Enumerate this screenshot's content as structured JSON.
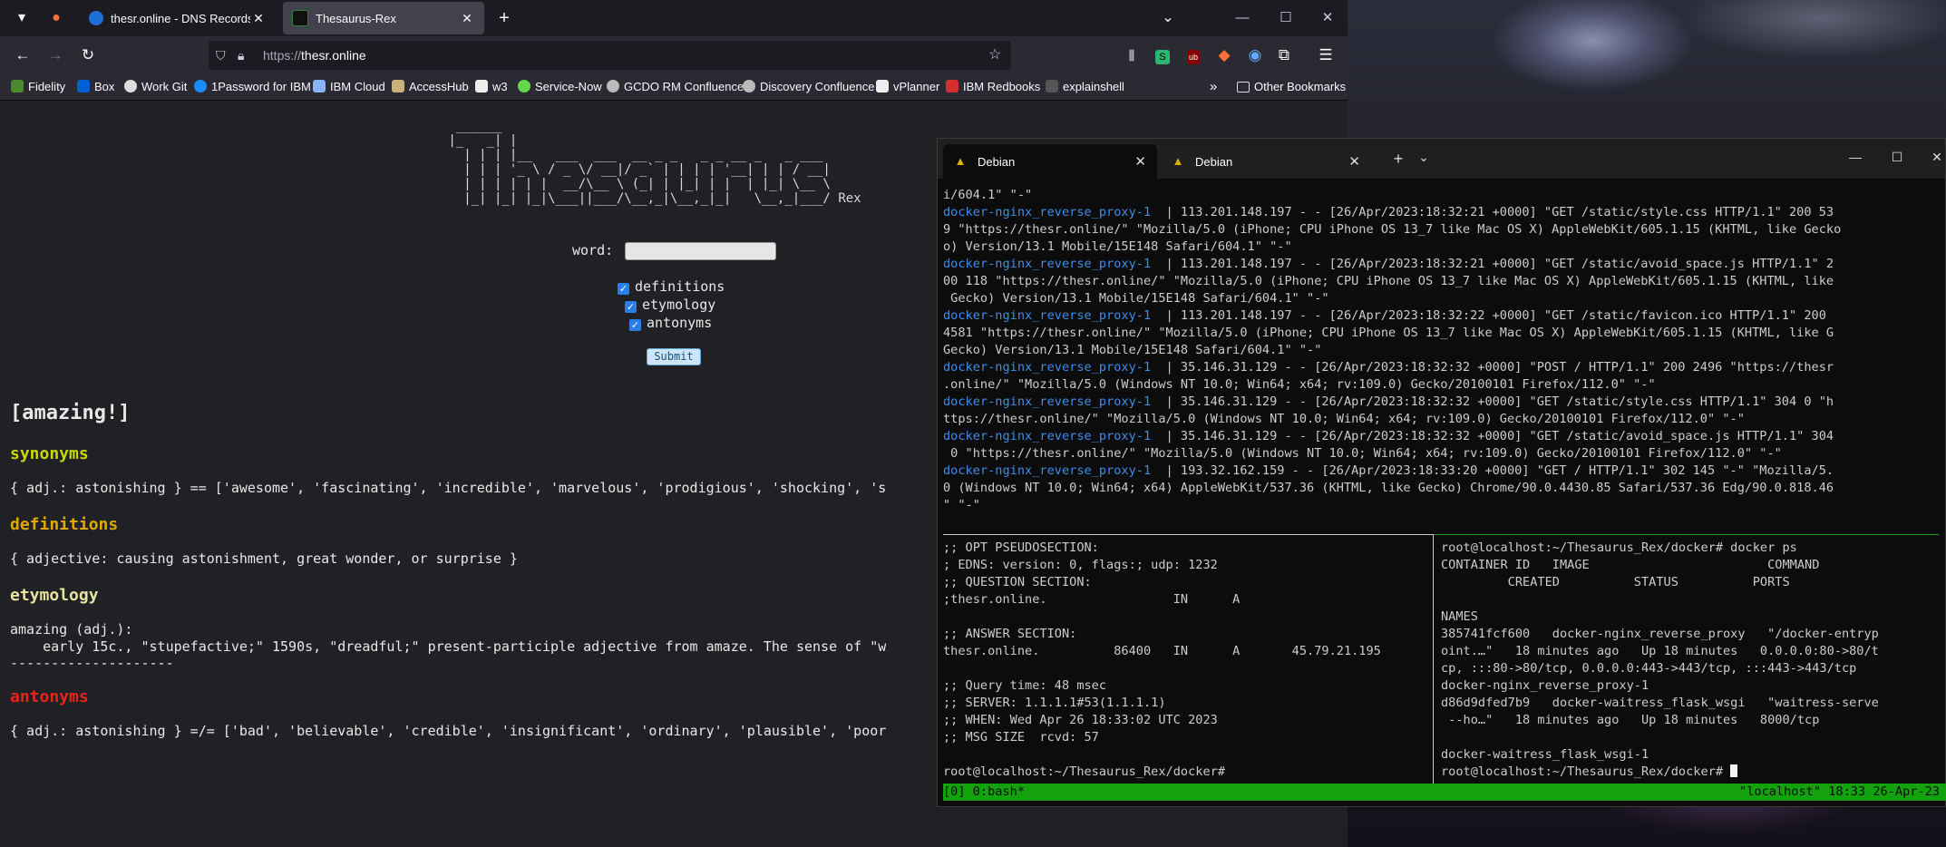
{
  "browser": {
    "tabs": [
      {
        "title": "thesr.online - DNS Records | Lin",
        "active": false
      },
      {
        "title": "Thesaurus-Rex",
        "active": true
      }
    ],
    "url_prefix": "https://",
    "url_host": "thesr.online",
    "bookmarks": [
      "Fidelity",
      "Box",
      "Work Git",
      "1Password for IBM",
      "IBM Cloud",
      "AccessHub",
      "w3",
      "Service-Now",
      "GCDO RM Confluence",
      "Discovery Confluence",
      "vPlanner",
      "IBM Redbooks",
      "explainshell"
    ],
    "other_bookmarks": "Other Bookmarks"
  },
  "page": {
    "logo_ascii": "  ______                                          \n |_   _| |                                        \n   | | | |__   ___  ___  __ _ _   _ _ __ _   _ ___ \n   | | | '_ \\ / _ \\/ __|/ _` | | | | '__| | | / __|\n   | | | | | |  __/\\__ \\ (_| | |_| | |  | |_| \\__ \\\n   |_| |_| |_|\\___||___/\\__,_|\\__,_|_|   \\__,_|___/",
    "logo_suffix": "Rex",
    "word_label": "word:",
    "options": [
      "definitions",
      "etymology",
      "antonyms"
    ],
    "submit_label": "Submit",
    "result_title": "[amazing!]",
    "synonyms_heading": "synonyms",
    "synonyms_body": "{ adj.: astonishing } == ['awesome', 'fascinating', 'incredible', 'marvelous', 'prodigious', 'shocking', 's",
    "definitions_heading": "definitions",
    "definitions_body": "{ adjective: causing astonishment, great wonder, or surprise }",
    "etymology_heading": "etymology",
    "etymology_line1": "amazing (adj.):",
    "etymology_line2": "    early 15c., \"stupefactive;\" 1590s, \"dreadful;\" present-participle adjective from amaze. The sense of \"w",
    "etymology_rule": "--------------------",
    "antonyms_heading": "antonyms",
    "antonyms_body": "{ adj.: astonishing } =/= ['bad', 'believable', 'credible', 'insignificant', 'ordinary', 'plausible', 'poor",
    "colors": {
      "synonyms": "#c8d800",
      "definitions": "#e0a800",
      "etymology": "#e6e2a0",
      "antonyms": "#e8241a"
    }
  },
  "terminal": {
    "tabs": [
      "Debian",
      "Debian"
    ],
    "log_lines": [
      {
        "prefix": "",
        "text": "i/604.1\" \"-\""
      },
      {
        "prefix": "docker-nginx_reverse_proxy-1",
        "text": "  | 113.201.148.197 - - [26/Apr/2023:18:32:21 +0000] \"GET /static/style.css HTTP/1.1\" 200 53"
      },
      {
        "prefix": "",
        "text": "9 \"https://thesr.online/\" \"Mozilla/5.0 (iPhone; CPU iPhone OS 13_7 like Mac OS X) AppleWebKit/605.1.15 (KHTML, like Gecko"
      },
      {
        "prefix": "",
        "text": "o) Version/13.1 Mobile/15E148 Safari/604.1\" \"-\""
      },
      {
        "prefix": "docker-nginx_reverse_proxy-1",
        "text": "  | 113.201.148.197 - - [26/Apr/2023:18:32:21 +0000] \"GET /static/avoid_space.js HTTP/1.1\" 2"
      },
      {
        "prefix": "",
        "text": "00 118 \"https://thesr.online/\" \"Mozilla/5.0 (iPhone; CPU iPhone OS 13_7 like Mac OS X) AppleWebKit/605.1.15 (KHTML, like"
      },
      {
        "prefix": "",
        "text": " Gecko) Version/13.1 Mobile/15E148 Safari/604.1\" \"-\""
      },
      {
        "prefix": "docker-nginx_reverse_proxy-1",
        "text": "  | 113.201.148.197 - - [26/Apr/2023:18:32:22 +0000] \"GET /static/favicon.ico HTTP/1.1\" 200"
      },
      {
        "prefix": "",
        "text": "4581 \"https://thesr.online/\" \"Mozilla/5.0 (iPhone; CPU iPhone OS 13_7 like Mac OS X) AppleWebKit/605.1.15 (KHTML, like G"
      },
      {
        "prefix": "",
        "text": "Gecko) Version/13.1 Mobile/15E148 Safari/604.1\" \"-\""
      },
      {
        "prefix": "docker-nginx_reverse_proxy-1",
        "text": "  | 35.146.31.129 - - [26/Apr/2023:18:32:32 +0000] \"POST / HTTP/1.1\" 200 2496 \"https://thesr"
      },
      {
        "prefix": "",
        "text": ".online/\" \"Mozilla/5.0 (Windows NT 10.0; Win64; x64; rv:109.0) Gecko/20100101 Firefox/112.0\" \"-\""
      },
      {
        "prefix": "docker-nginx_reverse_proxy-1",
        "text": "  | 35.146.31.129 - - [26/Apr/2023:18:32:32 +0000] \"GET /static/style.css HTTP/1.1\" 304 0 \"h"
      },
      {
        "prefix": "",
        "text": "ttps://thesr.online/\" \"Mozilla/5.0 (Windows NT 10.0; Win64; x64; rv:109.0) Gecko/20100101 Firefox/112.0\" \"-\""
      },
      {
        "prefix": "docker-nginx_reverse_proxy-1",
        "text": "  | 35.146.31.129 - - [26/Apr/2023:18:32:32 +0000] \"GET /static/avoid_space.js HTTP/1.1\" 304"
      },
      {
        "prefix": "",
        "text": " 0 \"https://thesr.online/\" \"Mozilla/5.0 (Windows NT 10.0; Win64; x64; rv:109.0) Gecko/20100101 Firefox/112.0\" \"-\""
      },
      {
        "prefix": "docker-nginx_reverse_proxy-1",
        "text": "  | 193.32.162.159 - - [26/Apr/2023:18:33:20 +0000] \"GET / HTTP/1.1\" 302 145 \"-\" \"Mozilla/5."
      },
      {
        "prefix": "",
        "text": "0 (Windows NT 10.0; Win64; x64) AppleWebKit/537.36 (KHTML, like Gecko) Chrome/90.0.4430.85 Safari/537.36 Edg/90.0.818.46"
      },
      {
        "prefix": "",
        "text": "\" \"-\""
      }
    ],
    "dig_lines": [
      ";; OPT PSEUDOSECTION:",
      "; EDNS: version: 0, flags:; udp: 1232",
      ";; QUESTION SECTION:",
      ";thesr.online.                 IN      A",
      "",
      ";; ANSWER SECTION:",
      "thesr.online.          86400   IN      A       45.79.21.195",
      "",
      ";; Query time: 48 msec",
      ";; SERVER: 1.1.1.1#53(1.1.1.1)",
      ";; WHEN: Wed Apr 26 18:33:02 UTC 2023",
      ";; MSG SIZE  rcvd: 57",
      "",
      "root@localhost:~/Thesaurus_Rex/docker#"
    ],
    "ps_lines": [
      "root@localhost:~/Thesaurus_Rex/docker# docker ps",
      "CONTAINER ID   IMAGE                        COMMAND",
      "         CREATED          STATUS          PORTS",
      "",
      "NAMES",
      "385741fcf600   docker-nginx_reverse_proxy   \"/docker-entryp",
      "oint.…\"   18 minutes ago   Up 18 minutes   0.0.0.0:80->80/t",
      "cp, :::80->80/tcp, 0.0.0.0:443->443/tcp, :::443->443/tcp",
      "docker-nginx_reverse_proxy-1",
      "d86d9dfed7b9   docker-waitress_flask_wsgi   \"waitress-serve",
      " --ho…\"   18 minutes ago   Up 18 minutes   8000/tcp",
      "",
      "docker-waitress_flask_wsgi-1",
      "root@localhost:~/Thesaurus_Rex/docker# "
    ],
    "status_left": "[0] 0:bash*",
    "status_right": "\"localhost\" 18:33 26-Apr-23"
  }
}
